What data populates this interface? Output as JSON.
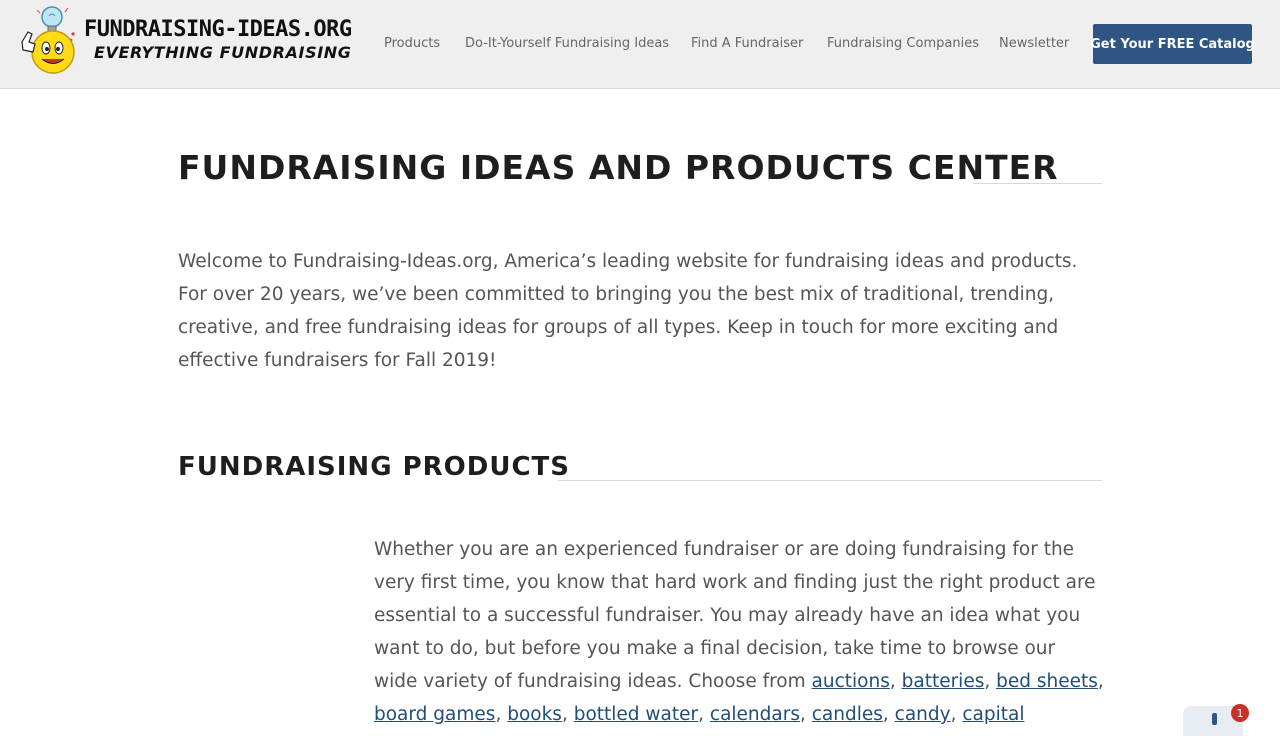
{
  "header": {
    "logo": {
      "title": "FUNDRAISING-IDEAS.ORG",
      "tagline": "EVERYTHING FUNDRAISING"
    },
    "nav": [
      {
        "label": "Products"
      },
      {
        "label": "Do-It-Yourself Fundraising Ideas"
      },
      {
        "label": "Find A Fundraiser"
      },
      {
        "label": "Fundraising Companies"
      },
      {
        "label": "Newsletter"
      }
    ],
    "cta_label": "Get Your FREE Catalog"
  },
  "main": {
    "title": "FUNDRAISING IDEAS AND PRODUCTS CENTER",
    "intro": "Welcome to Fundraising-Ideas.org, America’s leading website for fundraising ideas and products. For over 20 years, we’ve been committed to bringing you the best mix of traditional, trending, creative, and free fundraising ideas for groups of all types. Keep in touch for more exciting and effective fundraisers for Fall 2019!",
    "products_heading": "FUNDRAISING PRODUCTS",
    "products_text": "Whether you are an experienced fundraiser or are doing fundraising for the very first time, you know that hard work and finding just the right product are essential to a successful fundraiser. You may already have an idea what you want to do, but before you make a final decision, take time to browse our wide variety of fundraising ideas. Choose from",
    "product_links": [
      "auctions",
      "batteries",
      "bed sheets",
      "board games",
      "books",
      "bottled water",
      "calendars",
      "candles",
      "candy",
      "capital"
    ]
  },
  "widget": {
    "badge_count": "1",
    "icon": "info-icon"
  },
  "colors": {
    "header_bg": "#efefef",
    "cta_bg": "#2e5583",
    "link": "#1f4e79",
    "badge": "#c9302c"
  }
}
